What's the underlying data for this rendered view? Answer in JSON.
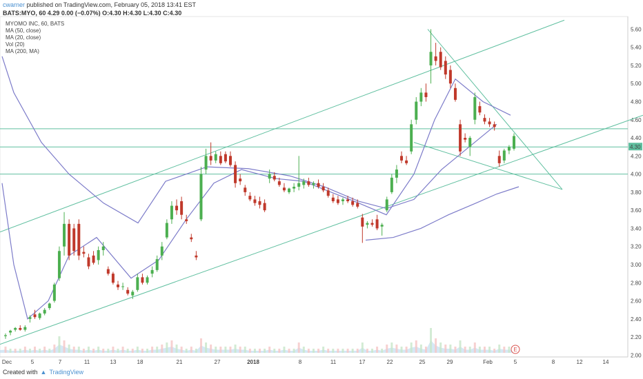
{
  "header": {
    "user": "cwarner",
    "published": "published on TradingView.com, February 05, 2018 13:41 EST",
    "quote": "BATS:MYO, 60  4.29  0.00 (−0.07%)  O:4.30  H:4.30  L:4.30  C:4.30"
  },
  "legend": [
    "MYOMO INC, 60, BATS",
    "MA (50, close)",
    "MA (20, close)",
    "Vol (20)",
    "MA (200, MA)"
  ],
  "footer": {
    "prefix": "Created with",
    "brand": "TradingView"
  },
  "colors": {
    "up": "#4caf50",
    "down": "#c0392b",
    "trend": "#5fbf9f",
    "ma_fast": "#7c7bc9",
    "ma_slow": "#7c7bc9",
    "volume": "#b9d9ee",
    "price_badge": "#5fbf9f",
    "earnings": "#d9534f"
  },
  "chart_data": {
    "type": "candlestick",
    "x_ticks": [
      "Dec",
      "5",
      "7",
      "11",
      "13",
      "18",
      "21",
      "27",
      "2018",
      "8",
      "11",
      "17",
      "22",
      "25",
      "29",
      "Feb",
      "5",
      "8",
      "12",
      "14"
    ],
    "y_ticks": [
      2.0,
      2.2,
      2.4,
      2.6,
      2.8,
      3.0,
      3.2,
      3.4,
      3.6,
      3.8,
      4.0,
      4.2,
      4.4,
      4.6,
      4.8,
      5.0,
      5.2,
      5.4,
      5.6
    ],
    "ylim": [
      1.98,
      5.74
    ],
    "last_price": "4.30",
    "earnings_marker": "E",
    "candles": [
      {
        "o": 2.21,
        "h": 2.24,
        "l": 2.18,
        "c": 2.22
      },
      {
        "o": 2.25,
        "h": 2.28,
        "l": 2.22,
        "c": 2.27
      },
      {
        "o": 2.28,
        "h": 2.31,
        "l": 2.26,
        "c": 2.3
      },
      {
        "o": 2.3,
        "h": 2.33,
        "l": 2.27,
        "c": 2.28
      },
      {
        "o": 2.28,
        "h": 2.33,
        "l": 2.26,
        "c": 2.31
      },
      {
        "o": 2.4,
        "h": 2.44,
        "l": 2.36,
        "c": 2.42
      },
      {
        "o": 2.45,
        "h": 2.5,
        "l": 2.4,
        "c": 2.42
      },
      {
        "o": 2.41,
        "h": 2.47,
        "l": 2.39,
        "c": 2.46
      },
      {
        "o": 2.46,
        "h": 2.52,
        "l": 2.44,
        "c": 2.5
      },
      {
        "o": 2.52,
        "h": 2.58,
        "l": 2.5,
        "c": 2.57
      },
      {
        "o": 2.6,
        "h": 2.8,
        "l": 2.58,
        "c": 2.78
      },
      {
        "o": 2.85,
        "h": 3.2,
        "l": 2.82,
        "c": 3.15
      },
      {
        "o": 3.2,
        "h": 3.58,
        "l": 3.1,
        "c": 3.45
      },
      {
        "o": 3.45,
        "h": 3.5,
        "l": 3.05,
        "c": 3.1
      },
      {
        "o": 3.4,
        "h": 3.45,
        "l": 3.1,
        "c": 3.15
      },
      {
        "o": 3.45,
        "h": 3.5,
        "l": 3.05,
        "c": 3.1
      },
      {
        "o": 3.14,
        "h": 3.2,
        "l": 3.08,
        "c": 3.12
      },
      {
        "o": 3.08,
        "h": 3.12,
        "l": 2.95,
        "c": 2.98
      },
      {
        "o": 3.1,
        "h": 3.15,
        "l": 3.0,
        "c": 3.02
      },
      {
        "o": 3.05,
        "h": 3.2,
        "l": 3.0,
        "c": 3.16
      },
      {
        "o": 3.16,
        "h": 3.25,
        "l": 3.1,
        "c": 3.2
      },
      {
        "o": 2.95,
        "h": 2.98,
        "l": 2.88,
        "c": 2.9
      },
      {
        "o": 2.9,
        "h": 2.92,
        "l": 2.78,
        "c": 2.8
      },
      {
        "o": 2.78,
        "h": 2.82,
        "l": 2.72,
        "c": 2.75
      },
      {
        "o": 2.76,
        "h": 2.8,
        "l": 2.72,
        "c": 2.76
      },
      {
        "o": 2.72,
        "h": 2.75,
        "l": 2.66,
        "c": 2.68
      },
      {
        "o": 2.66,
        "h": 2.72,
        "l": 2.62,
        "c": 2.7
      },
      {
        "o": 2.72,
        "h": 2.9,
        "l": 2.7,
        "c": 2.86
      },
      {
        "o": 2.86,
        "h": 2.9,
        "l": 2.78,
        "c": 2.8
      },
      {
        "o": 2.8,
        "h": 2.88,
        "l": 2.78,
        "c": 2.86
      },
      {
        "o": 2.9,
        "h": 2.98,
        "l": 2.86,
        "c": 2.94
      },
      {
        "o": 2.94,
        "h": 3.1,
        "l": 2.92,
        "c": 3.06
      },
      {
        "o": 3.1,
        "h": 3.25,
        "l": 3.05,
        "c": 3.2
      },
      {
        "o": 3.3,
        "h": 3.5,
        "l": 3.28,
        "c": 3.46
      },
      {
        "o": 3.5,
        "h": 3.7,
        "l": 3.45,
        "c": 3.65
      },
      {
        "o": 3.65,
        "h": 3.72,
        "l": 3.55,
        "c": 3.6
      },
      {
        "o": 3.7,
        "h": 3.75,
        "l": 3.5,
        "c": 3.55
      },
      {
        "o": 3.5,
        "h": 3.55,
        "l": 3.45,
        "c": 3.48
      },
      {
        "o": 3.3,
        "h": 3.34,
        "l": 3.25,
        "c": 3.28
      },
      {
        "o": 3.1,
        "h": 3.15,
        "l": 3.05,
        "c": 3.08
      },
      {
        "o": 3.5,
        "h": 4.08,
        "l": 3.48,
        "c": 4.0
      },
      {
        "o": 4.05,
        "h": 4.28,
        "l": 4.0,
        "c": 4.2
      },
      {
        "o": 4.2,
        "h": 4.35,
        "l": 4.1,
        "c": 4.15
      },
      {
        "o": 4.15,
        "h": 4.25,
        "l": 4.12,
        "c": 4.22
      },
      {
        "o": 4.2,
        "h": 4.25,
        "l": 4.1,
        "c": 4.12
      },
      {
        "o": 4.22,
        "h": 4.25,
        "l": 4.12,
        "c": 4.14
      },
      {
        "o": 4.2,
        "h": 4.25,
        "l": 4.08,
        "c": 4.1
      },
      {
        "o": 4.1,
        "h": 4.14,
        "l": 3.85,
        "c": 3.9
      },
      {
        "o": 3.95,
        "h": 4.0,
        "l": 3.88,
        "c": 3.92
      },
      {
        "o": 3.85,
        "h": 3.88,
        "l": 3.76,
        "c": 3.8
      },
      {
        "o": 3.76,
        "h": 3.8,
        "l": 3.7,
        "c": 3.72
      },
      {
        "o": 3.72,
        "h": 3.76,
        "l": 3.65,
        "c": 3.68
      },
      {
        "o": 3.7,
        "h": 3.75,
        "l": 3.62,
        "c": 3.66
      },
      {
        "o": 3.68,
        "h": 3.72,
        "l": 3.58,
        "c": 3.6
      },
      {
        "o": 3.95,
        "h": 4.05,
        "l": 3.9,
        "c": 4.0
      },
      {
        "o": 3.98,
        "h": 4.02,
        "l": 3.92,
        "c": 3.94
      },
      {
        "o": 3.92,
        "h": 3.96,
        "l": 3.86,
        "c": 3.88
      },
      {
        "o": 3.85,
        "h": 3.9,
        "l": 3.8,
        "c": 3.82
      },
      {
        "o": 3.8,
        "h": 3.85,
        "l": 3.78,
        "c": 3.84
      },
      {
        "o": 3.84,
        "h": 3.9,
        "l": 3.8,
        "c": 3.86
      },
      {
        "o": 3.86,
        "h": 4.2,
        "l": 3.82,
        "c": 3.9
      },
      {
        "o": 3.88,
        "h": 3.95,
        "l": 3.84,
        "c": 3.92
      },
      {
        "o": 3.92,
        "h": 3.96,
        "l": 3.86,
        "c": 3.88
      },
      {
        "o": 3.88,
        "h": 3.92,
        "l": 3.84,
        "c": 3.9
      },
      {
        "o": 3.9,
        "h": 3.94,
        "l": 3.84,
        "c": 3.86
      },
      {
        "o": 3.86,
        "h": 3.9,
        "l": 3.8,
        "c": 3.82
      },
      {
        "o": 3.82,
        "h": 3.85,
        "l": 3.74,
        "c": 3.76
      },
      {
        "o": 3.74,
        "h": 3.78,
        "l": 3.68,
        "c": 3.7
      },
      {
        "o": 3.72,
        "h": 3.76,
        "l": 3.66,
        "c": 3.68
      },
      {
        "o": 3.7,
        "h": 3.74,
        "l": 3.66,
        "c": 3.72
      },
      {
        "o": 3.72,
        "h": 3.76,
        "l": 3.68,
        "c": 3.7
      },
      {
        "o": 3.7,
        "h": 3.74,
        "l": 3.64,
        "c": 3.66
      },
      {
        "o": 3.68,
        "h": 3.72,
        "l": 3.62,
        "c": 3.64
      },
      {
        "o": 3.52,
        "h": 3.56,
        "l": 3.24,
        "c": 3.42
      },
      {
        "o": 3.44,
        "h": 3.48,
        "l": 3.4,
        "c": 3.46
      },
      {
        "o": 3.46,
        "h": 3.5,
        "l": 3.42,
        "c": 3.44
      },
      {
        "o": 3.5,
        "h": 3.55,
        "l": 3.38,
        "c": 3.4
      },
      {
        "o": 3.42,
        "h": 3.46,
        "l": 3.32,
        "c": 3.44
      },
      {
        "o": 3.6,
        "h": 3.75,
        "l": 3.58,
        "c": 3.72
      },
      {
        "o": 3.8,
        "h": 4.0,
        "l": 3.78,
        "c": 3.96
      },
      {
        "o": 3.96,
        "h": 4.1,
        "l": 3.9,
        "c": 4.05
      },
      {
        "o": 4.2,
        "h": 4.25,
        "l": 4.12,
        "c": 4.15
      },
      {
        "o": 4.15,
        "h": 4.2,
        "l": 4.1,
        "c": 4.12
      },
      {
        "o": 4.25,
        "h": 4.6,
        "l": 4.22,
        "c": 4.55
      },
      {
        "o": 4.6,
        "h": 4.85,
        "l": 4.55,
        "c": 4.8
      },
      {
        "o": 4.8,
        "h": 4.95,
        "l": 4.75,
        "c": 4.9
      },
      {
        "o": 4.9,
        "h": 5.0,
        "l": 4.8,
        "c": 4.85
      },
      {
        "o": 5.2,
        "h": 5.6,
        "l": 5.0,
        "c": 5.35
      },
      {
        "o": 5.3,
        "h": 5.45,
        "l": 5.2,
        "c": 5.25
      },
      {
        "o": 5.35,
        "h": 5.4,
        "l": 5.15,
        "c": 5.18
      },
      {
        "o": 5.25,
        "h": 5.3,
        "l": 5.05,
        "c": 5.1
      },
      {
        "o": 5.15,
        "h": 5.2,
        "l": 4.95,
        "c": 5.0
      },
      {
        "o": 4.95,
        "h": 5.0,
        "l": 4.8,
        "c": 4.82
      },
      {
        "o": 4.55,
        "h": 4.6,
        "l": 4.2,
        "c": 4.25
      },
      {
        "o": 4.4,
        "h": 4.45,
        "l": 4.35,
        "c": 4.38
      },
      {
        "o": 4.3,
        "h": 4.42,
        "l": 4.2,
        "c": 4.4
      },
      {
        "o": 4.6,
        "h": 4.9,
        "l": 4.55,
        "c": 4.85
      },
      {
        "o": 4.75,
        "h": 4.8,
        "l": 4.65,
        "c": 4.68
      },
      {
        "o": 4.62,
        "h": 4.66,
        "l": 4.55,
        "c": 4.58
      },
      {
        "o": 4.58,
        "h": 4.62,
        "l": 4.52,
        "c": 4.55
      },
      {
        "o": 4.55,
        "h": 4.58,
        "l": 4.48,
        "c": 4.52
      },
      {
        "o": 4.2,
        "h": 4.26,
        "l": 4.08,
        "c": 4.12
      },
      {
        "o": 4.15,
        "h": 4.28,
        "l": 4.12,
        "c": 4.26
      },
      {
        "o": 4.26,
        "h": 4.32,
        "l": 4.22,
        "c": 4.3
      },
      {
        "o": 4.28,
        "h": 4.45,
        "l": 4.26,
        "c": 4.42
      }
    ],
    "ma50": [
      [
        3,
        5.3
      ],
      [
        20,
        4.9
      ],
      [
        60,
        4.35
      ],
      [
        100,
        4.0
      ],
      [
        150,
        3.68
      ],
      [
        200,
        3.46
      ],
      [
        240,
        3.92
      ],
      [
        300,
        4.08
      ],
      [
        360,
        4.06
      ],
      [
        420,
        3.98
      ],
      [
        470,
        3.86
      ],
      [
        520,
        3.7
      ],
      [
        560,
        3.62
      ],
      [
        600,
        3.72
      ],
      [
        640,
        4.05
      ],
      [
        680,
        4.3
      ],
      [
        720,
        4.55
      ]
    ],
    "ma20": [
      [
        3,
        3.9
      ],
      [
        20,
        3.0
      ],
      [
        40,
        2.4
      ],
      [
        70,
        2.6
      ],
      [
        100,
        3.1
      ],
      [
        140,
        3.3
      ],
      [
        190,
        2.85
      ],
      [
        230,
        3.05
      ],
      [
        270,
        3.5
      ],
      [
        310,
        3.9
      ],
      [
        350,
        4.05
      ],
      [
        400,
        3.95
      ],
      [
        440,
        3.92
      ],
      [
        480,
        3.8
      ],
      [
        520,
        3.68
      ],
      [
        560,
        3.55
      ],
      [
        600,
        4.0
      ],
      [
        630,
        4.6
      ],
      [
        660,
        5.05
      ],
      [
        700,
        4.8
      ],
      [
        740,
        4.65
      ]
    ],
    "ma200": [
      [
        530,
        3.27
      ],
      [
        570,
        3.3
      ],
      [
        610,
        3.4
      ],
      [
        650,
        3.55
      ],
      [
        690,
        3.68
      ],
      [
        720,
        3.78
      ],
      [
        752,
        3.86
      ]
    ],
    "trendlines": [
      {
        "x1": 0,
        "y1": 3.36,
        "x2": 818,
        "y2": 5.7
      },
      {
        "x1": 0,
        "y1": 2.12,
        "x2": 932,
        "y2": 4.65
      },
      {
        "x1": 620,
        "y1": 5.6,
        "x2": 815,
        "y2": 3.83
      },
      {
        "x1": 600,
        "y1": 4.35,
        "x2": 815,
        "y2": 3.83
      },
      {
        "x1": 0,
        "y1": 4.5,
        "x2": 910,
        "y2": 4.5
      },
      {
        "x1": 0,
        "y1": 4.3,
        "x2": 910,
        "y2": 4.3
      },
      {
        "x1": 0,
        "y1": 4.0,
        "x2": 910,
        "y2": 4.0
      }
    ],
    "volume": [
      3,
      2,
      2,
      2,
      3,
      2,
      3,
      2,
      3,
      2,
      4,
      8,
      6,
      4,
      3,
      3,
      2,
      3,
      2,
      3,
      2,
      2,
      3,
      2,
      3,
      2,
      2,
      3,
      2,
      2,
      3,
      3,
      4,
      5,
      6,
      4,
      3,
      2,
      3,
      2,
      7,
      5,
      4,
      3,
      3,
      3,
      3,
      4,
      3,
      3,
      2,
      2,
      2,
      2,
      3,
      2,
      2,
      3,
      2,
      2,
      5,
      3,
      2,
      2,
      2,
      3,
      2,
      2,
      2,
      2,
      2,
      2,
      2,
      5,
      2,
      2,
      3,
      2,
      4,
      5,
      4,
      3,
      3,
      5,
      6,
      4,
      3,
      12,
      7,
      5,
      4,
      4,
      3,
      6,
      3,
      3,
      5,
      3,
      3,
      3,
      2,
      4,
      3,
      3,
      2
    ]
  }
}
